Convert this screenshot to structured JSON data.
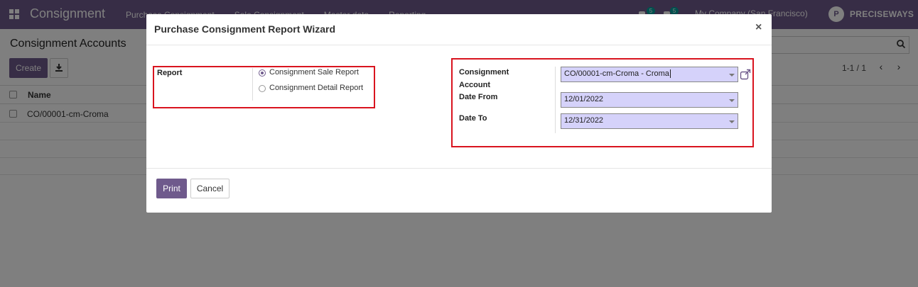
{
  "navbar": {
    "app_title": "Consignment",
    "menu": [
      "Purchase Consignment",
      "Sale Consignment",
      "Master data",
      "Reporting"
    ],
    "activity_badge": "5",
    "message_badge": "5",
    "company": "My Company (San Francisco)",
    "brand": "PRECISEWAYS"
  },
  "control_panel": {
    "title": "Consignment Accounts",
    "create_label": "Create",
    "pager": "1-1 / 1"
  },
  "list": {
    "column_name": "Name",
    "rows": [
      "CO/00001-cm-Croma"
    ]
  },
  "modal": {
    "title": "Purchase Consignment Report Wizard",
    "close_symbol": "×",
    "report_label": "Report",
    "report_options": [
      "Consignment Sale Report",
      "Consignment Detail Report"
    ],
    "selected_report": "Consignment Sale Report",
    "account_label_line1": "Consignment",
    "account_label_line2": "Account",
    "account_value": "CO/00001-cm-Croma - Croma",
    "date_from_label": "Date From",
    "date_from_value": "12/01/2022",
    "date_to_label": "Date To",
    "date_to_value": "12/31/2022",
    "print_label": "Print",
    "cancel_label": "Cancel"
  },
  "colors": {
    "brand": "#6f5a8c",
    "highlight_border": "#d9141f",
    "field_bg": "#d5d2fa"
  }
}
